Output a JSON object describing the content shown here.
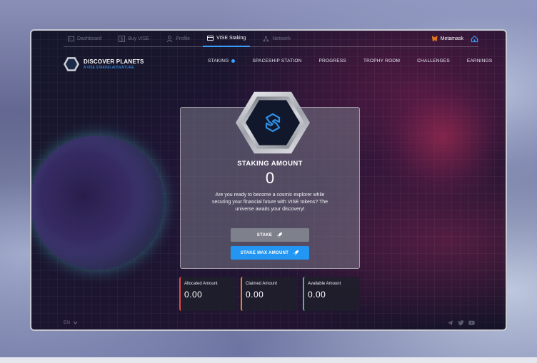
{
  "topnav": {
    "tabs": [
      {
        "label": "Dashboard",
        "icon": "dashboard-icon"
      },
      {
        "label": "Buy VISE",
        "icon": "dollar-icon"
      },
      {
        "label": "Profile",
        "icon": "user-icon"
      },
      {
        "label": "VISE Staking",
        "icon": "card-icon",
        "active": true
      },
      {
        "label": "Network",
        "icon": "network-icon"
      }
    ],
    "wallet": "Metamask"
  },
  "brand": {
    "title": "DISCOVER PLANETS",
    "subtitle": "A VISE STAKING ADVENTURE"
  },
  "mainnav": {
    "items": [
      "STAKING",
      "SPACESHIP STATION",
      "PROGRESS",
      "TROPHY ROOM",
      "CHALLENGES",
      "EARNINGS"
    ]
  },
  "card": {
    "title": "STAKING AMOUNT",
    "amount": "0",
    "description": "Are you ready to become a cosmic explorer while securing your financial future with VISE tokens? The universe awaits your discovery!",
    "stake_label": "STAKE",
    "stake_max_label": "STAKE MAX AMOUNT"
  },
  "stats": [
    {
      "label": "Allocated Amount",
      "value": "0.00",
      "color": "#e14a4a"
    },
    {
      "label": "Claimed Amount",
      "value": "0.00",
      "color": "#e7832d"
    },
    {
      "label": "Available Amount",
      "value": "0.00",
      "color": "#3ec47a"
    }
  ],
  "footer": {
    "language": "EN",
    "socials": [
      "telegram-icon",
      "twitter-icon",
      "youtube-icon"
    ]
  },
  "colors": {
    "accent": "#2396f3",
    "active_tab_underline": "#3aa0ff"
  }
}
